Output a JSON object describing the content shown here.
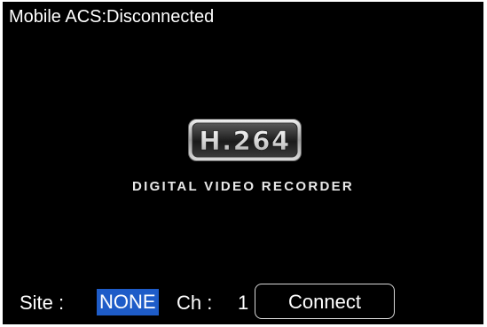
{
  "status": {
    "title": "Mobile ACS:Disconnected"
  },
  "logo": {
    "badge_text": "H.264",
    "icon": "h264-logo-icon"
  },
  "subtitle": "DIGITAL VIDEO RECORDER",
  "controls": {
    "site_label": "Site :",
    "site_value": "NONE",
    "ch_label": "Ch :",
    "ch_value": "1",
    "connect_label": "Connect"
  },
  "colors": {
    "background": "#000000",
    "text": "#ffffff",
    "selection_highlight": "#1e5cc8"
  }
}
